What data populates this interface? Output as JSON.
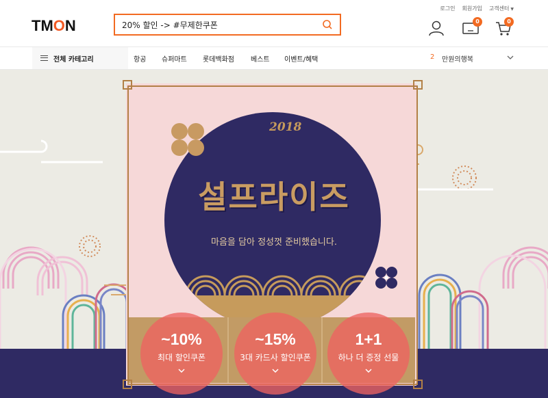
{
  "header": {
    "logo_text": "TMON",
    "top_links": [
      "로그인",
      "회원가입",
      "고객센터"
    ],
    "search_value": "20% 할인 -> #무제한쿠폰",
    "cart_count": "0",
    "recent_count": "0"
  },
  "nav": {
    "category_label": "전체 카테고리",
    "items": [
      "항공",
      "슈퍼마트",
      "롯데백화점",
      "베스트",
      "이벤트/혜택"
    ],
    "rank_number": "2",
    "rank_text": "만원의행복"
  },
  "banner": {
    "year": "2018",
    "title": "설프라이즈",
    "subtitle": "마음을 담아 정성껏 준비했습니다.",
    "offers": [
      {
        "big": "~10%",
        "small": "최대 할인쿠폰"
      },
      {
        "big": "~15%",
        "small": "3대 카드사 할인쿠폰"
      },
      {
        "big": "1+1",
        "small": "하나 더 증정 선물"
      }
    ]
  },
  "colors": {
    "accent": "#f26a21",
    "navy": "#2f2a63",
    "gold": "#c99c62",
    "pink": "#f6d8d8"
  },
  "icons": [
    "search-icon",
    "user-icon",
    "recent-view-icon",
    "cart-icon",
    "menu-icon",
    "chevron-down-icon"
  ]
}
